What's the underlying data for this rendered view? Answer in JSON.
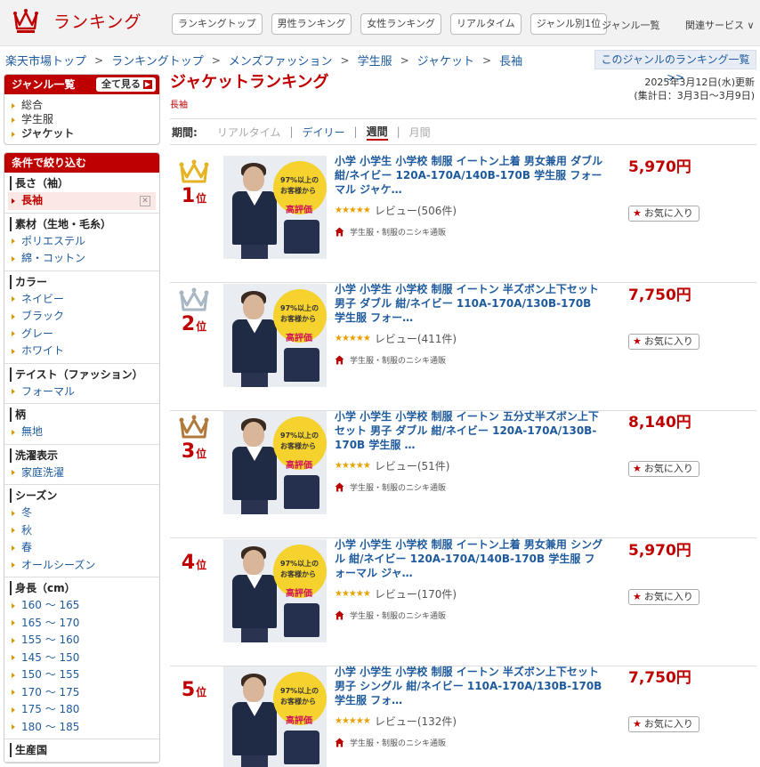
{
  "header": {
    "logo_text": "ランキング",
    "nav": [
      "ランキングトップ",
      "男性ランキング",
      "女性ランキング",
      "リアルタイム",
      "ジャンル別1位"
    ],
    "genre_list_label": "ジャンル一覧",
    "related_label": "関連サービス ∨"
  },
  "breadcrumb": [
    "楽天市場トップ",
    "ランキングトップ",
    "メンズファッション",
    "学生服",
    "ジャケット",
    "長袖"
  ],
  "breadcrumb_sep": ">",
  "genre_ranking_link": "このジャンルのランキング一覧 >>",
  "sidebar": {
    "genre_header": "ジャンル一覧",
    "show_all": "全て見る",
    "genres": [
      "総合",
      "学生服",
      "ジャケット"
    ],
    "filter_header": "条件で絞り込む",
    "groups": [
      {
        "title": "長さ（袖）",
        "options": [
          "長袖"
        ],
        "selected": "長袖"
      },
      {
        "title": "素材（生地・毛糸）",
        "options": [
          "ポリエステル",
          "綿・コットン"
        ]
      },
      {
        "title": "カラー",
        "options": [
          "ネイビー",
          "ブラック",
          "グレー",
          "ホワイト"
        ]
      },
      {
        "title": "テイスト（ファッション）",
        "options": [
          "フォーマル"
        ]
      },
      {
        "title": "柄",
        "options": [
          "無地"
        ]
      },
      {
        "title": "洗濯表示",
        "options": [
          "家庭洗濯"
        ]
      },
      {
        "title": "シーズン",
        "options": [
          "冬",
          "秋",
          "春",
          "オールシーズン"
        ]
      },
      {
        "title": "身長（cm）",
        "options": [
          "160 ～ 165",
          "165 ～ 170",
          "155 ～ 160",
          "145 ～ 150",
          "150 ～ 155",
          "170 ～ 175",
          "175 ～ 180",
          "180 ～ 185"
        ]
      },
      {
        "title": "生産国",
        "options": []
      }
    ]
  },
  "main": {
    "title": "ジャケットランキング",
    "subgenre": "長袖",
    "updated_line1": "2025年3月12日(水)更新",
    "updated_line2": "(集計日：3月3日～3月9日)",
    "period_label": "期間:",
    "periods": [
      {
        "label": "リアルタイム",
        "state": "disabled"
      },
      {
        "label": "デイリー",
        "state": "link"
      },
      {
        "label": "週間",
        "state": "current"
      },
      {
        "label": "月間",
        "state": "disabled"
      }
    ],
    "rank_suffix": "位",
    "review_prefix": "レビュー",
    "fav_label": "お気に入り",
    "thumb_badge_line1": "97%以上の",
    "thumb_badge_line2": "お客様から",
    "thumb_badge_line3": "高評価",
    "items": [
      {
        "rank": "1",
        "crown": "#e6b422",
        "title": "小学 小学生 小学校 制服 イートン上着 男女兼用 ダブル 紺/ネイビー 120A-170A/140B-170B 学生服 フォーマル ジャケ…",
        "rating": "★★★★★",
        "reviews": "(506件)",
        "shop": "学生服・制服のニシキ通販",
        "price": "5,970円"
      },
      {
        "rank": "2",
        "crown": "#a9b6c4",
        "title": "小学 小学生 小学校 制服 イートン 半ズボン上下セット 男子 ダブル 紺/ネイビー 110A-170A/130B-170B 学生服 フォー…",
        "rating": "★★★★★",
        "reviews": "(411件)",
        "shop": "学生服・制服のニシキ通販",
        "price": "7,750円"
      },
      {
        "rank": "3",
        "crown": "#b07a3c",
        "title": "小学 小学生 小学校 制服 イートン 五分丈半ズボン上下セット 男子 ダブル 紺/ネイビー 120A-170A/130B-170B 学生服 …",
        "rating": "★★★★★",
        "reviews": "(51件)",
        "shop": "学生服・制服のニシキ通販",
        "price": "8,140円"
      },
      {
        "rank": "4",
        "crown": "",
        "title": "小学 小学生 小学校 制服 イートン上着 男女兼用 シングル 紺/ネイビー 120A-170A/140B-170B 学生服 フォーマル ジャ…",
        "rating": "★★★★★",
        "reviews": "(170件)",
        "shop": "学生服・制服のニシキ通販",
        "price": "5,970円"
      },
      {
        "rank": "5",
        "crown": "",
        "title": "小学 小学生 小学校 制服 イートン 半ズボン上下セット 男子 シングル 紺/ネイビー 110A-170A/130B-170B 学生服 フォ…",
        "rating": "★★★★★",
        "reviews": "(132件)",
        "shop": "学生服・制服のニシキ通販",
        "price": "7,750円"
      }
    ]
  },
  "colors": {
    "accent": "#bf0000",
    "link": "#1e5a9c",
    "star": "#e8a100"
  }
}
